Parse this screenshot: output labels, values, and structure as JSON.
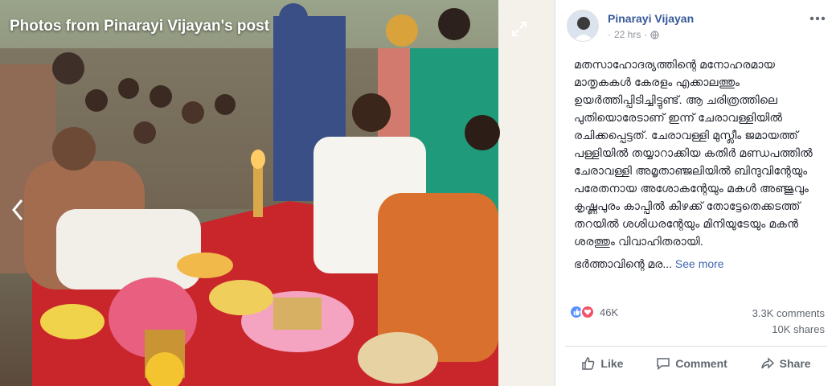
{
  "viewer": {
    "title": "Photos from Pinarayi Vijayan's post",
    "expand_icon": "expand-icon",
    "prev_icon": "chevron-left-icon"
  },
  "post": {
    "author": "Pinarayi Vijayan",
    "time": "22 hrs",
    "audience_icon": "globe-icon",
    "more_icon": "more-horizontal-icon",
    "text": "മതസാഹോദര്യത്തിന്റെ മനോഹരമായ മാതൃകകൾ കേരളം എക്കാലത്തും ഉയർത്തിപ്പിടിച്ചിട്ടുണ്ട്. ആ ചരിത്രത്തിലെ പുതിയൊരേടാണ് ഇന്ന് ചേരാവള്ളിയിൽ രചിക്കപ്പെട്ടത്. ചേരാവള്ളി മുസ്ലീം ജമായത്ത് പള്ളിയിൽ തയ്യാറാക്കിയ കതിർ മണ്ഡപത്തിൽ ചേരാവള്ളി അമൃതാഞ്ജലിയിൽ ബിന്ദുവിന്റേയും പരേതനായ അശോകന്റേയും മകൾ അഞ്ജുവും കൃഷ്ണപുരം കാപ്പിൽ കിഴക്ക് തോട്ടേതെക്കടത്ത് തറയിൽ ശശിധരന്റേയും മിനിയുടേയും മകൻ ശരത്തും വിവാഹിതരായി.",
    "text_more": "ഭർത്താവിന്റെ മര...",
    "see_more": "See more"
  },
  "stats": {
    "reactions": "46K",
    "comments": "3.3K comments",
    "shares": "10K shares"
  },
  "actions": {
    "like": "Like",
    "comment": "Comment",
    "share": "Share"
  },
  "colors": {
    "link": "#365899",
    "see_more": "#4267b2",
    "like_reaction": "#5890ff",
    "love_reaction": "#f25268",
    "secondary_text": "#606770"
  }
}
